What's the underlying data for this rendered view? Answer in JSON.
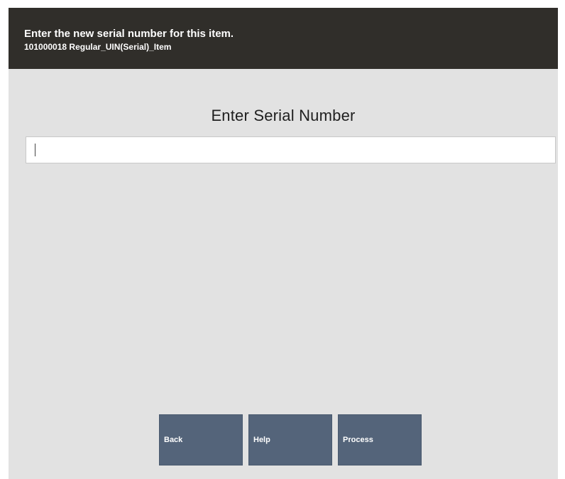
{
  "header": {
    "prompt": "Enter the new serial number for this item.",
    "item_line": "101000018 Regular_UIN(Serial)_Item"
  },
  "main": {
    "title": "Enter Serial Number",
    "serial_input": {
      "value": "",
      "placeholder": ""
    }
  },
  "buttons": {
    "back_label": "Back",
    "help_label": "Help",
    "process_label": "Process"
  },
  "colors": {
    "header_background": "#302e2a",
    "body_background": "#e2e2e2",
    "button_background": "#54647a",
    "header_text": "#ffffff"
  }
}
